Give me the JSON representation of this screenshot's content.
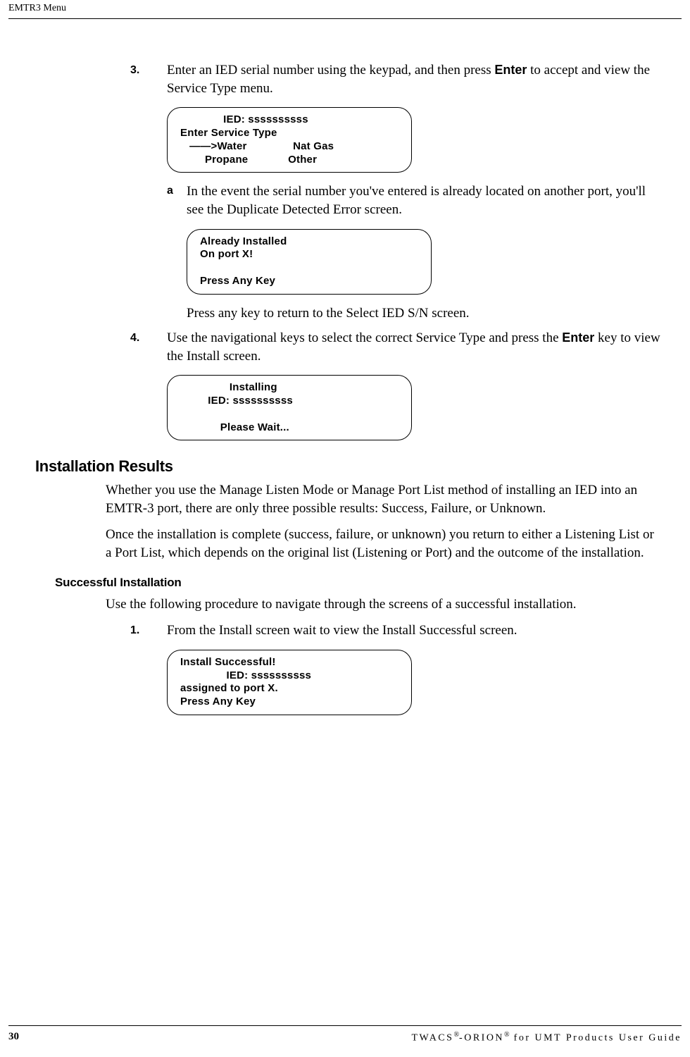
{
  "header": {
    "section": "EMTR3 Menu"
  },
  "steps": {
    "step3": {
      "num": "3.",
      "text_before": "Enter an IED serial number using the keypad, and then press ",
      "enter": "Enter",
      "text_after": " to accept and view the Service Type menu."
    },
    "step3_sub_a": {
      "letter": "a",
      "text": "In the event the serial number you've entered is already located on another port, you'll see the Duplicate Detected Error screen."
    },
    "step3_sub_after": "Press any key to return to the Select IED S/N screen.",
    "step4": {
      "num": "4.",
      "text_before": "Use the navigational keys to select the correct Service Type and press the ",
      "enter": "Enter",
      "text_after": " key to view the Install screen."
    },
    "step1b": {
      "num": "1.",
      "text": "From the Install screen wait to view the Install Successful screen."
    }
  },
  "screens": {
    "service_type": "              IED: ssssssssss\nEnter Service Type\n   ——>Water               Nat Gas\n        Propane             Other",
    "already_installed": "Already Installed\nOn port X!\n\nPress Any Key",
    "installing": "                Installing\n         IED: ssssssssss\n\n             Please Wait...",
    "install_success": "Install Successful!\n               IED: ssssssssss\nassigned to port X.\nPress Any Key"
  },
  "headings": {
    "installation_results": "Installation Results",
    "successful_installation": "Successful Installation"
  },
  "paragraphs": {
    "p1": "Whether you use the Manage Listen Mode or Manage Port List method of installing an IED into an EMTR-3 port, there are only three possible results: Success, Failure, or Unknown.",
    "p2": "Once the installation is complete (success, failure, or unknown) you return to either a Listening List or a Port List, which depends on the original list (Listening or Port) and the outcome of the installation.",
    "p3": "Use the following procedure to navigate through the screens of a successful installation."
  },
  "footer": {
    "page": "30",
    "title_a": "TWACS",
    "reg": "®",
    "title_b": "-ORION",
    "title_c": " for UMT Products User Guide"
  }
}
